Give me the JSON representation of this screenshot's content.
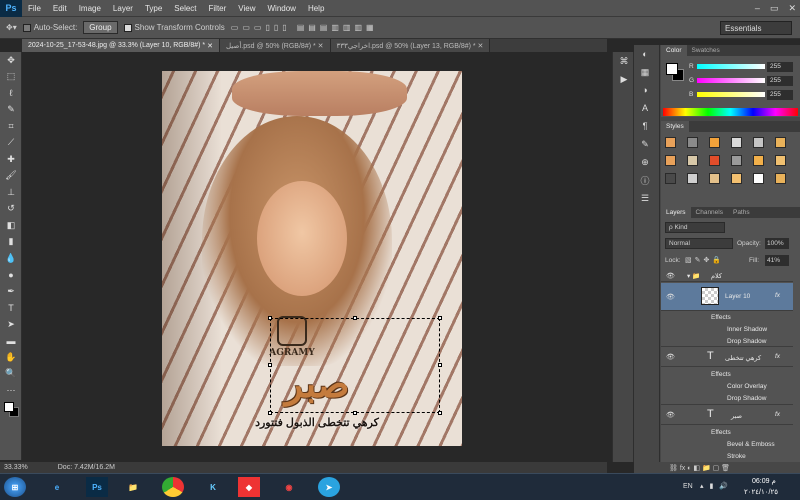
{
  "app": {
    "logo": "Ps"
  },
  "menu": [
    "File",
    "Edit",
    "Image",
    "Layer",
    "Type",
    "Select",
    "Filter",
    "View",
    "Window",
    "Help"
  ],
  "window_controls": [
    "–",
    "▭",
    "✕"
  ],
  "options": {
    "auto_select_label": "Auto-Select:",
    "auto_select_value": "Group",
    "transform_label": "Show Transform Controls",
    "workspace": "Essentials"
  },
  "tabs": [
    {
      "label": "2024-10-25_17-53-48.jpg @ 33.3% (Layer 10, RGB/8#) *",
      "active": true
    },
    {
      "label": "أصيل.psd @ 50% (RGB/8#) *",
      "active": false
    },
    {
      "label": "اخراجي٣٣٣.psd @ 50% (Layer 13, RGB/8#) *",
      "active": false
    }
  ],
  "document": {
    "brand_text": "AGRAMY",
    "headline": "صبر",
    "caption": "كرهي تتخطى الذبول فتتورد"
  },
  "status": {
    "zoom": "33.33%",
    "doc": "Doc: 7.42M/16.2M"
  },
  "color_panel": {
    "tabs": [
      "Color",
      "Swatches"
    ],
    "channels": [
      {
        "label": "R",
        "value": "255"
      },
      {
        "label": "G",
        "value": "255"
      },
      {
        "label": "B",
        "value": "255"
      }
    ]
  },
  "styles_panel": {
    "tab": "Styles",
    "swatch_colors": [
      "#e8a15a",
      "#8a8a8a",
      "#f2a23a",
      "#d9d9d9",
      "#c4c4c4",
      "#e9b25a",
      "#e8a15a",
      "#d8c8a8",
      "#e24d2a",
      "#9a9a9a",
      "#f2b04a",
      "#f0c070",
      "#4a4a4a",
      "#d0d0d0",
      "#e3c08a",
      "#f3c070",
      "#ffffff",
      "#e9b25a"
    ]
  },
  "layers_panel": {
    "tabs": [
      "Layers",
      "Channels",
      "Paths"
    ],
    "kind": "ρ Kind",
    "blend": "Normal",
    "opacity_label": "Opacity:",
    "opacity": "100%",
    "lock_label": "Lock:",
    "fill_label": "Fill:",
    "fill": "41%",
    "group_name": "كلام",
    "layers": [
      {
        "name": "Layer 10",
        "effects_label": "Effects",
        "effects": [
          "Inner Shadow",
          "Drop Shadow"
        ],
        "selected": true
      },
      {
        "name": "كرهي تتخطى",
        "effects_label": "Effects",
        "effects": [
          "Color Overlay",
          "Drop Shadow"
        ],
        "selected": false
      },
      {
        "name": "صبر",
        "effects_label": "Effects",
        "effects": [
          "Bevel & Emboss",
          "Stroke"
        ],
        "selected": false
      }
    ]
  },
  "taskbar": {
    "lang": "EN",
    "time": "06:09 م",
    "date": "٢٠٢٤/١٠/٢٥"
  }
}
